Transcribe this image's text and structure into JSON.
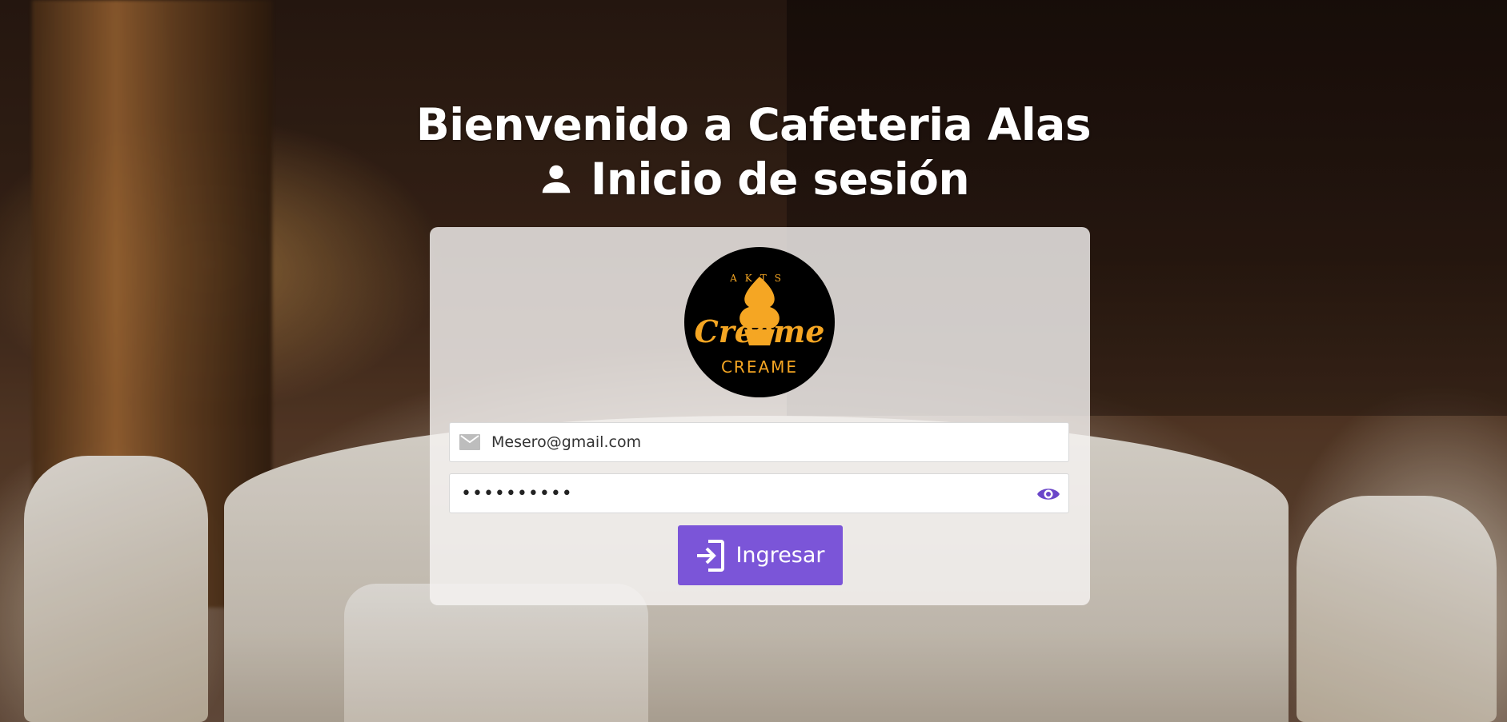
{
  "header": {
    "welcome": "Bienvenido a Cafeteria Alas",
    "login_title": "Inicio de sesión",
    "user_icon": "user-icon"
  },
  "logo": {
    "brand_top": "AKTS",
    "brand_script": "Creeme",
    "brand_bottom": "CREAME",
    "colors": {
      "background": "#000000",
      "accent": "#f5a623"
    }
  },
  "form": {
    "email": {
      "value": "Mesero@gmail.com",
      "icon": "mail-icon"
    },
    "password": {
      "value": "••••••••••",
      "icon": "eye-icon"
    },
    "submit": {
      "label": "Ingresar",
      "icon": "login-icon"
    }
  },
  "colors": {
    "primary": "#7b55d8",
    "eye": "#6a46c9"
  }
}
